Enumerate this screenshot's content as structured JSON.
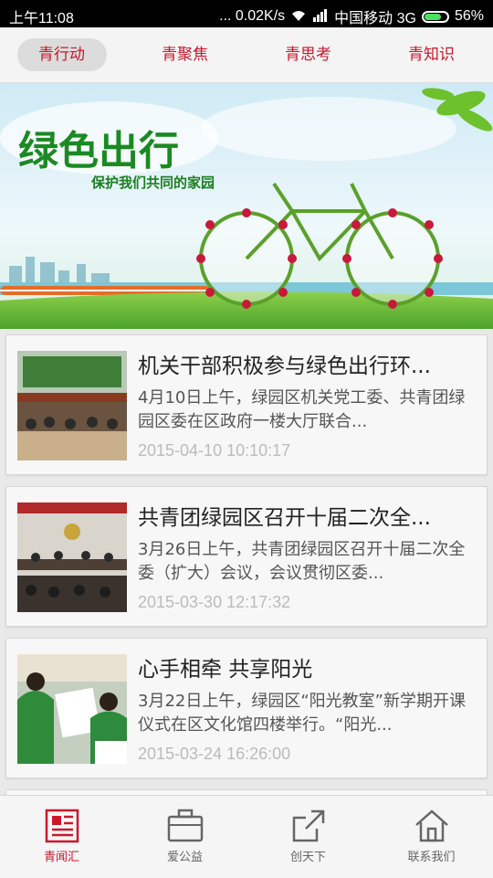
{
  "status_bar": {
    "time": "上午11:08",
    "speed": "... 0.02K/s",
    "carrier": "中国移动 3G",
    "battery": "56%"
  },
  "tabs": [
    {
      "label": "青行动",
      "active": true
    },
    {
      "label": "青聚焦",
      "active": false
    },
    {
      "label": "青思考",
      "active": false
    },
    {
      "label": "青知识",
      "active": false
    }
  ],
  "banner": {
    "title": "绿色出行",
    "subtitle": "保护我们共同的家园"
  },
  "articles": [
    {
      "title": "机关干部积极参与绿色出行环...",
      "desc": "4月10日上午，绿园区机关党工委、共青团绿园区委在区政府一楼大厅联合...",
      "date": "2015-04-10 10:10:17"
    },
    {
      "title": "共青团绿园区召开十届二次全...",
      "desc": "3月26日上午，共青团绿园区召开十届二次全委（扩大）会议，会议贯彻区委...",
      "date": "2015-03-30 12:17:32"
    },
    {
      "title": "心手相牵 共享阳光",
      "desc": "3月22日上午，绿园区“阳光教室”新学期开课仪式在区文化馆四楼举行。“阳光...",
      "date": "2015-03-24 16:26:00"
    }
  ],
  "bottom_nav": [
    {
      "label": "青闻汇",
      "icon": "newspaper-icon",
      "active": true
    },
    {
      "label": "爱公益",
      "icon": "briefcase-icon",
      "active": false
    },
    {
      "label": "创天下",
      "icon": "share-out-icon",
      "active": false
    },
    {
      "label": "联系我们",
      "icon": "home-icon",
      "active": false
    }
  ],
  "colors": {
    "accent": "#c8182a",
    "status_battery": "#49e060"
  }
}
